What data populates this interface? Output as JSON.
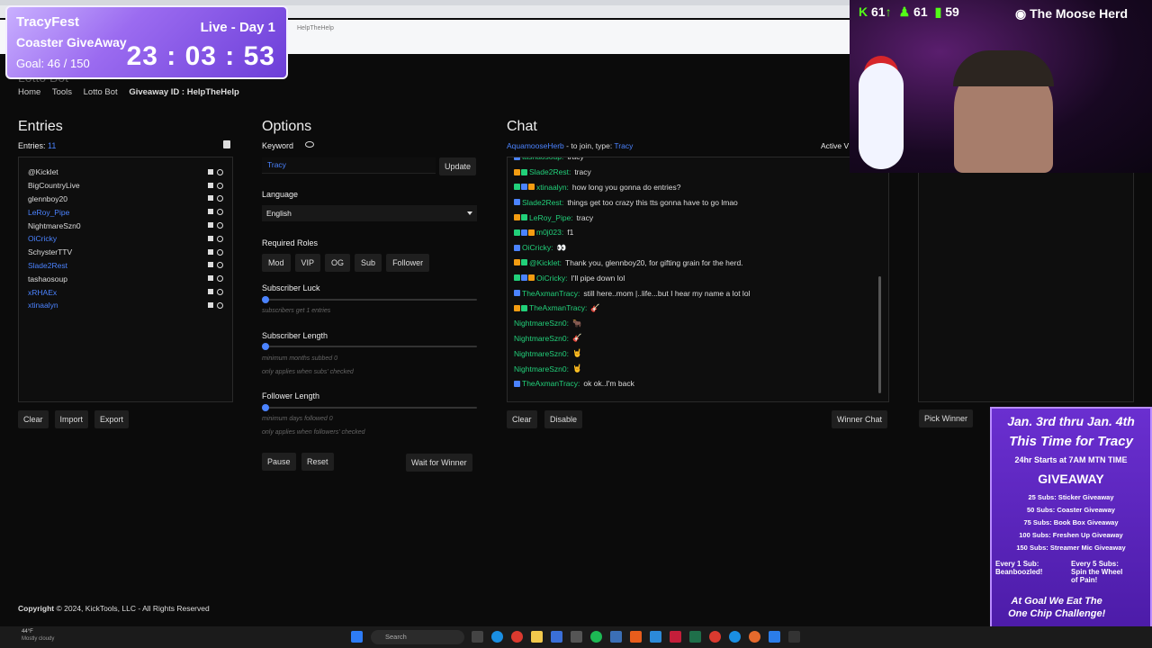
{
  "browser": {
    "url": "HelpTheHelp"
  },
  "page": {
    "title": "Lotto Bot"
  },
  "breadcrumb": [
    "Home",
    "Tools",
    "Lotto Bot",
    "Giveaway ID : HelpTheHelp"
  ],
  "entries": {
    "heading": "Entries",
    "count_label": "Entries:",
    "count": "11",
    "items": [
      {
        "name": "@Kicklet",
        "blue": false
      },
      {
        "name": "BigCountryLive",
        "blue": false
      },
      {
        "name": "glennboy20",
        "blue": false
      },
      {
        "name": "LeRoy_Pipe",
        "blue": true
      },
      {
        "name": "NightmareSzn0",
        "blue": false
      },
      {
        "name": "OiCricky",
        "blue": true
      },
      {
        "name": "SchysterTTV",
        "blue": false
      },
      {
        "name": "Slade2Rest",
        "blue": true
      },
      {
        "name": "tashaosoup",
        "blue": false
      },
      {
        "name": "xRHAEx",
        "blue": true
      },
      {
        "name": "xtinaalyn",
        "blue": true
      }
    ],
    "buttons": {
      "clear": "Clear",
      "import": "Import",
      "export": "Export"
    }
  },
  "options": {
    "heading": "Options",
    "keyword_label": "Keyword",
    "keyword_value": "Tracy",
    "update": "Update",
    "language_label": "Language",
    "language_value": "English",
    "roles_label": "Required Roles",
    "roles": [
      "Mod",
      "VIP",
      "OG",
      "Sub",
      "Follower"
    ],
    "sub_luck": {
      "label": "Subscriber Luck",
      "hint": "subscribers get 1 entries",
      "value": 0
    },
    "sub_length": {
      "label": "Subscriber Length",
      "hint1": "minimum months subbed 0",
      "hint2": "only applies when subs' checked",
      "value": 0
    },
    "follower_length": {
      "label": "Follower Length",
      "hint1": "minimum days followed 0",
      "hint2": "only applies when followers' checked",
      "value": 0
    },
    "pause": "Pause",
    "reset": "Reset",
    "wait": "Wait for Winner"
  },
  "chat": {
    "heading": "Chat",
    "join_user": "AquamooseHerb",
    "join_text": "- to join, type:",
    "join_keyword": "Tracy",
    "active": "Active V",
    "lines": [
      {
        "name": "tashaosoup:",
        "msg": "tracy",
        "blue": false
      },
      {
        "name": "Slade2Rest:",
        "msg": "tracy",
        "blue": false
      },
      {
        "name": "xtinaalyn:",
        "msg": "how long you gonna do entries?",
        "blue": false
      },
      {
        "name": "Slade2Rest:",
        "msg": "things get too crazy this tts gonna have to go lmao",
        "blue": false
      },
      {
        "name": "LeRoy_Pipe:",
        "msg": "tracy",
        "blue": false
      },
      {
        "name": "m0j023:",
        "msg": "f1",
        "blue": false
      },
      {
        "name": "OiCricky:",
        "msg": "👀",
        "blue": false
      },
      {
        "name": "@Kicklet:",
        "msg": "Thank you, glennboy20, for gifting grain for the herd.",
        "blue": false
      },
      {
        "name": "OiCricky:",
        "msg": "I'll pipe down lol",
        "blue": false
      },
      {
        "name": "TheAxmanTracy:",
        "msg": "still here..mom |..life...but I hear my name a lot lol",
        "blue": false
      },
      {
        "name": "TheAxmanTracy:",
        "msg": "🎸",
        "blue": false
      },
      {
        "name": "NightmareSzn0:",
        "msg": "🐂",
        "blue": false
      },
      {
        "name": "NightmareSzn0:",
        "msg": "🎸",
        "blue": false
      },
      {
        "name": "NightmareSzn0:",
        "msg": "🤘",
        "blue": false
      },
      {
        "name": "NightmareSzn0:",
        "msg": "🤘",
        "blue": false
      },
      {
        "name": "TheAxmanTracy:",
        "msg": "ok ok..I'm back",
        "blue": false
      }
    ],
    "clear": "Clear",
    "disable": "Disable",
    "winner_chat": "Winner Chat"
  },
  "winner": {
    "pick": "Pick Winner"
  },
  "footer": {
    "copyright_bold": "Copyright",
    "copyright": "© 2024, KickTools, LLC - All Rights Reserved"
  },
  "overlay": {
    "line1": "TracyFest",
    "line2": "Coaster GiveAway",
    "goal": "Goal: 46 / 150",
    "live": "Live - Day 1",
    "timer": "23 : 03 : 53"
  },
  "webcam": {
    "kick_count": "61",
    "follow_count": "61",
    "chart_count": "59",
    "discord": "The Moose Herd"
  },
  "poster": {
    "dates": "Jan. 3rd thru Jan. 4th",
    "tagline": "This Time for Tracy",
    "start": "24hr Starts at 7AM MTN TIME",
    "giveaway": "GIVEAWAY",
    "goals": [
      "25 Subs: Sticker Giveaway",
      "50 Subs: Coaster Giveaway",
      "75 Subs: Book Box Giveaway",
      "100 Subs: Freshen Up Giveaway",
      "150 Subs: Streamer Mic Giveaway"
    ],
    "every1": "Every 1 Sub: Beanboozled!",
    "every5": "Every 5 Subs: Spin the Wheel of Pain!",
    "goal_line1": "At Goal We Eat The",
    "goal_line2": "One Chip Challenge!"
  },
  "taskbar": {
    "weather_temp": "44°F",
    "weather_desc": "Mostly cloudy",
    "search": "Search"
  }
}
